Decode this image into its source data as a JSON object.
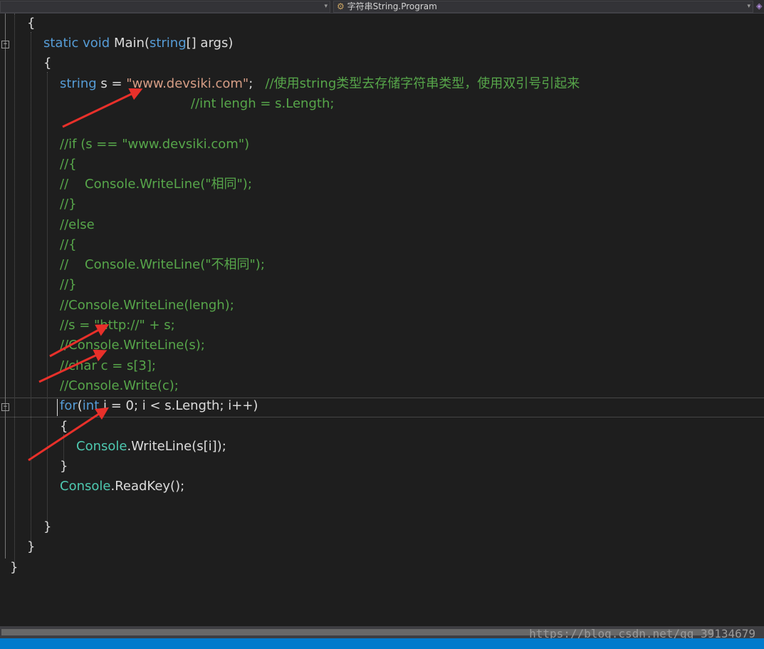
{
  "toolbar": {
    "left_dropdown_text": "",
    "right_dropdown_text": "字符串String.Program"
  },
  "code": {
    "l1": "{",
    "l2a": "static",
    "l2b": " void",
    "l2c": " Main(",
    "l2d": "string",
    "l2e": "[] args)",
    "l3": "{",
    "l4a": "string",
    "l4b": " s = ",
    "l4c": "\"www.devsiki.com\"",
    "l4d": ";   ",
    "l4e": "//使用string类型去存储字符串类型，使用双引号引起来",
    "l5": "//int lengh = s.Length;",
    "l7": "//if (s == \"www.devsiki.com\")",
    "l8": "//{",
    "l9": "//    Console.WriteLine(\"相同\");",
    "l10": "//}",
    "l11": "//else",
    "l12": "//{",
    "l13": "//    Console.WriteLine(\"不相同\");",
    "l14": "//}",
    "l15": "//Console.WriteLine(lengh);",
    "l16": "//s = \"http://\" + s;",
    "l17": "//Console.WriteLine(s);",
    "l18": "//char c = s[3];",
    "l19": "//Console.Write(c);",
    "l20a": "for",
    "l20b": "(",
    "l20c": "int",
    "l20d": " i = 0; i < s.Length; i++)",
    "l21": "{",
    "l22a": "Console",
    "l22b": ".WriteLine(s[i]);",
    "l23": "}",
    "l24a": "Console",
    "l24b": ".ReadKey();",
    "l26": "}",
    "l27": "}",
    "l28": "}"
  },
  "watermark": "https://blog.csdn.net/qq_39134679",
  "colors": {
    "background": "#1e1e1e",
    "keyword": "#569cd6",
    "string": "#d69d85",
    "comment": "#57a64a",
    "type": "#4ec9b0",
    "annotation_arrow": "#e8302a"
  }
}
